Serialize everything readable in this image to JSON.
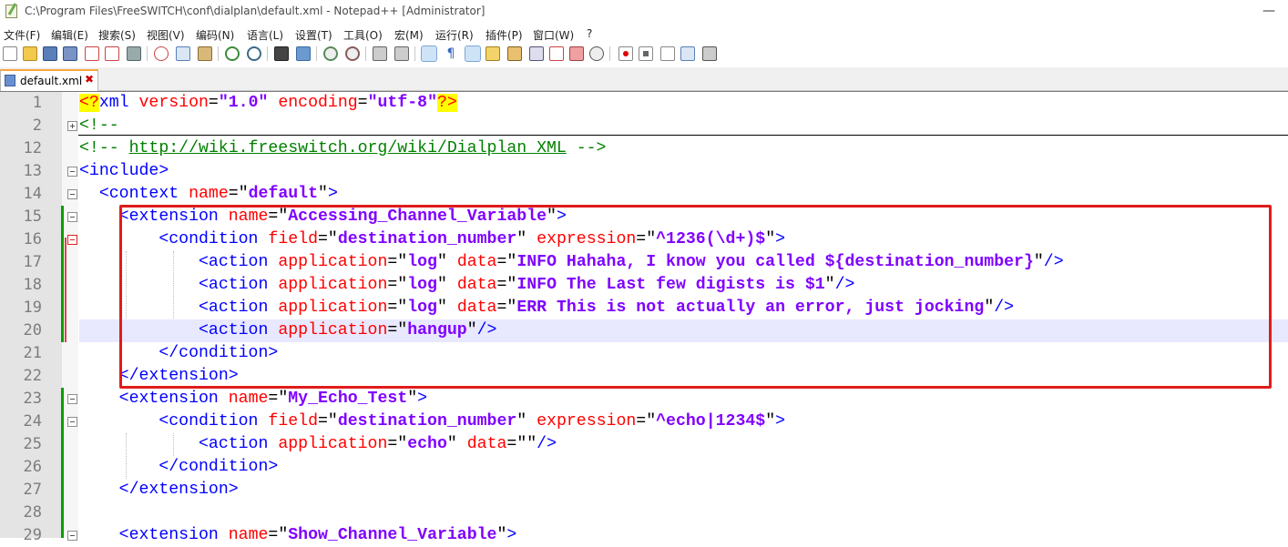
{
  "window": {
    "title": "C:\\Program Files\\FreeSWITCH\\conf\\dialplan\\default.xml - Notepad++ [Administrator]",
    "minimize": "—"
  },
  "menu": [
    "文件(F)",
    "编辑(E)",
    "搜索(S)",
    "视图(V)",
    "编码(N)",
    "语言(L)",
    "设置(T)",
    "工具(O)",
    "宏(M)",
    "运行(R)",
    "插件(P)",
    "窗口(W)",
    "?"
  ],
  "toolbar": {
    "icons": [
      "new-file-icon",
      "open-file-icon",
      "save-icon",
      "save-all-icon",
      "close-icon",
      "close-all-icon",
      "print-icon",
      "cut-icon",
      "copy-icon",
      "paste-icon",
      "undo-icon",
      "redo-icon",
      "find-icon",
      "replace-icon",
      "zoom-in-icon",
      "zoom-out-icon",
      "sync-vertical-icon",
      "sync-horizontal-icon",
      "word-wrap-icon",
      "show-all-chars-icon",
      "indent-guide-icon",
      "lang-icon",
      "doc-map-icon",
      "function-list-icon",
      "folder-as-workspace-icon",
      "monitoring-icon",
      "record-macro-icon",
      "stop-record-icon",
      "play-macro-icon",
      "run-macro-multiple-icon",
      "save-macro-icon"
    ],
    "active": [
      "word-wrap-icon",
      "indent-guide-icon"
    ]
  },
  "tabs": [
    {
      "label": "default.xml",
      "close": "✖"
    }
  ],
  "editor": {
    "current_line": "20",
    "lines": [
      {
        "n": "1"
      },
      {
        "n": "2"
      },
      {
        "n": "12"
      },
      {
        "n": "13"
      },
      {
        "n": "14"
      },
      {
        "n": "15"
      },
      {
        "n": "16"
      },
      {
        "n": "17"
      },
      {
        "n": "18"
      },
      {
        "n": "19"
      },
      {
        "n": "20"
      },
      {
        "n": "21"
      },
      {
        "n": "22"
      },
      {
        "n": "23"
      },
      {
        "n": "24"
      },
      {
        "n": "25"
      },
      {
        "n": "26"
      },
      {
        "n": "27"
      },
      {
        "n": "28"
      },
      {
        "n": "29"
      }
    ],
    "text": {
      "l1": {
        "pi_open": "<?",
        "xml": "xml",
        "version_attr": "version",
        "version_val": "\"1.0\"",
        "enc_attr": "encoding",
        "enc_val": "\"utf-8\"",
        "pi_close": "?>"
      },
      "l2": "<!--",
      "l12": {
        "open": "<!-- ",
        "url": "http://wiki.freeswitch.org/wiki/Dialplan_XML",
        "close": " -->"
      },
      "l13": "<include>",
      "l14": {
        "tag": "<context",
        "attr": "name",
        "val": "default",
        "end": ">"
      },
      "l15": {
        "tag": "<extension",
        "attr": "name",
        "val": "Accessing_Channel_Variable",
        "end": ">"
      },
      "l16": {
        "tag": "<condition",
        "attr1": "field",
        "val1": "destination_number",
        "attr2": "expression",
        "val2": "^1236(\\d+)$",
        "end": ">"
      },
      "l17": {
        "tag": "<action",
        "attr1": "application",
        "val1": "log",
        "attr2": "data",
        "val2": "INFO Hahaha, I know you called ${destination_number}",
        "end": "/>"
      },
      "l18": {
        "tag": "<action",
        "attr1": "application",
        "val1": "log",
        "attr2": "data",
        "val2": "INFO The Last few digists is $1",
        "end": "/>"
      },
      "l19": {
        "tag": "<action",
        "attr1": "application",
        "val1": "log",
        "attr2": "data",
        "val2": "ERR This is not actually an error, just jocking",
        "end": "/>"
      },
      "l20": {
        "tag": "<action",
        "attr1": "application",
        "val1": "hangup",
        "end": "/>"
      },
      "l21": "</condition>",
      "l22": "</extension>",
      "l23": {
        "tag": "<extension",
        "attr": "name",
        "val": "My_Echo_Test",
        "end": ">"
      },
      "l24": {
        "tag": "<condition",
        "attr1": "field",
        "val1": "destination_number",
        "attr2": "expression",
        "val2": "^echo|1234$",
        "end": ">"
      },
      "l25": {
        "tag": "<action",
        "attr1": "application",
        "val1": "echo",
        "attr2": "data",
        "val2": "",
        "end": "/>"
      },
      "l26": "</condition>",
      "l27": "</extension>",
      "l29": {
        "tag": "<extension",
        "attr": "name",
        "val": "Show_Channel_Variable",
        "end": ">"
      }
    }
  },
  "colors": {
    "tag": "#0000ff",
    "attribute": "#ff0000",
    "value": "#8000ff",
    "comment": "#008000",
    "highlight_box": "#e01b1b",
    "current_line": "#e8e8ff"
  }
}
